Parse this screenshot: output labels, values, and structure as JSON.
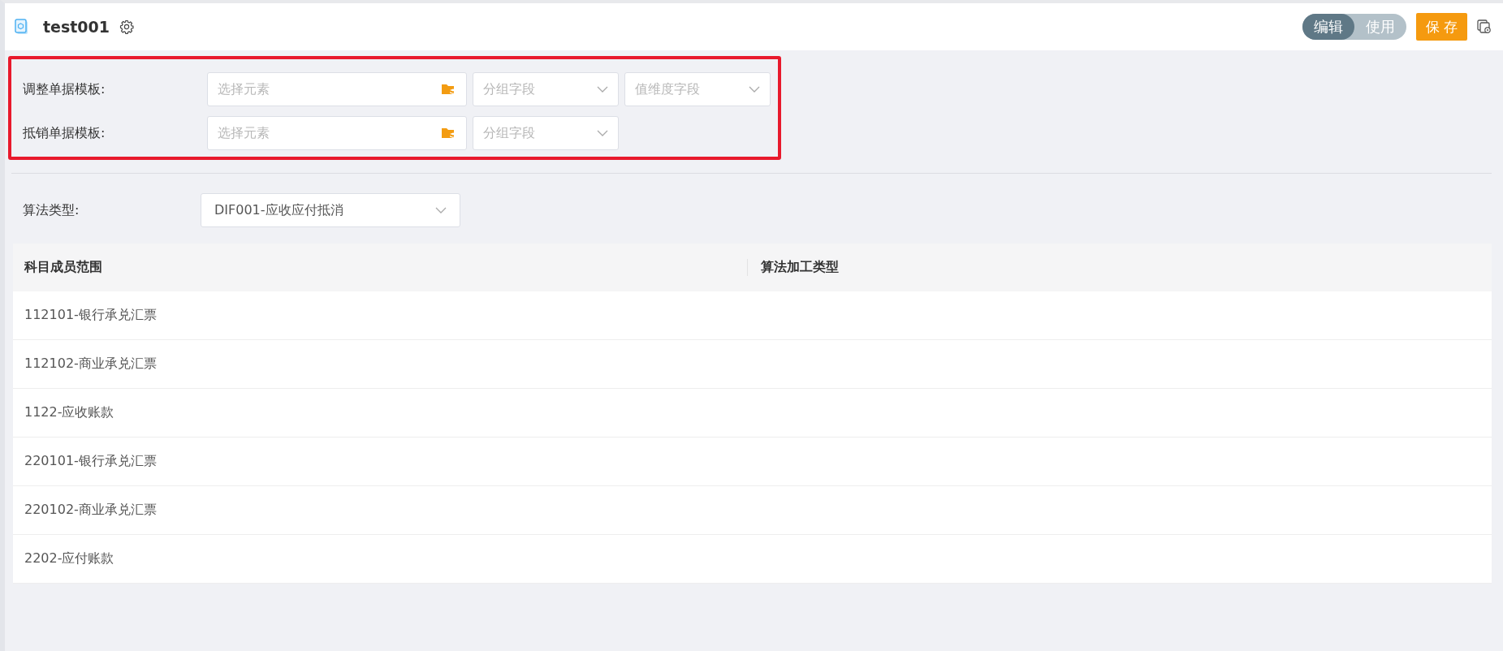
{
  "header": {
    "title": "test001",
    "mode_toggle": [
      {
        "label": "编辑",
        "selected": true
      },
      {
        "label": "使用",
        "selected": false
      }
    ],
    "save_button": "保 存"
  },
  "template_section": {
    "highlighted": true,
    "rows": [
      {
        "label": "调整单据模板:",
        "element_placeholder": "选择元素",
        "selects": [
          {
            "placeholder": "分组字段"
          },
          {
            "placeholder": "值维度字段"
          }
        ]
      },
      {
        "label": "抵销单据模板:",
        "element_placeholder": "选择元素",
        "selects": [
          {
            "placeholder": "分组字段"
          }
        ]
      }
    ]
  },
  "algorithm": {
    "label": "算法类型:",
    "value": "DIF001-应收应付抵消"
  },
  "table": {
    "columns": [
      "科目成员范围",
      "算法加工类型"
    ],
    "rows": [
      {
        "cells": [
          "112101-银行承兑汇票",
          ""
        ]
      },
      {
        "cells": [
          "112102-商业承兑汇票",
          ""
        ]
      },
      {
        "cells": [
          "1122-应收账款",
          ""
        ]
      },
      {
        "cells": [
          "220101-银行承兑汇票",
          ""
        ]
      },
      {
        "cells": [
          "220102-商业承兑汇票",
          ""
        ]
      },
      {
        "cells": [
          "2202-应付账款",
          ""
        ]
      }
    ]
  }
}
